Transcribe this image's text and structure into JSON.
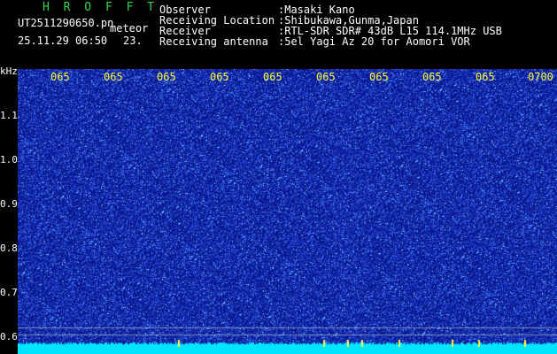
{
  "header": {
    "brand": "H R O F F T",
    "file_name": "UT2511290650.pn",
    "tag": "meteor",
    "datetime": "25.11.29 06:50",
    "value": "23.",
    "fields": [
      {
        "label": "Observer",
        "value": ":Masaki Kano"
      },
      {
        "label": "Receiving Location",
        "value": ":Shibukawa,Gunma,Japan"
      },
      {
        "label": "Receiver",
        "value": ":RTL-SDR SDR# 43dB L15 114.1MHz USB"
      },
      {
        "label": "Receiving antenna",
        "value": ":5el Yagi Az 20 for Aomori VOR"
      }
    ]
  },
  "yaxis": {
    "unit": "kHz",
    "ticks": [
      "1.1",
      "1.0",
      "0.9",
      "0.8",
      "0.7",
      "0.6"
    ]
  },
  "xaxis": {
    "ticks": [
      "065",
      "065",
      "065",
      "065",
      "065",
      "065",
      "065",
      "065",
      "065",
      "0700"
    ]
  },
  "colors": {
    "background": "#0a1a8c",
    "noise": "#3a78ff",
    "text": "#ffffff",
    "accent": "#2fd84a",
    "tick": "#ffff33",
    "baseline": "#00e5ff"
  }
}
